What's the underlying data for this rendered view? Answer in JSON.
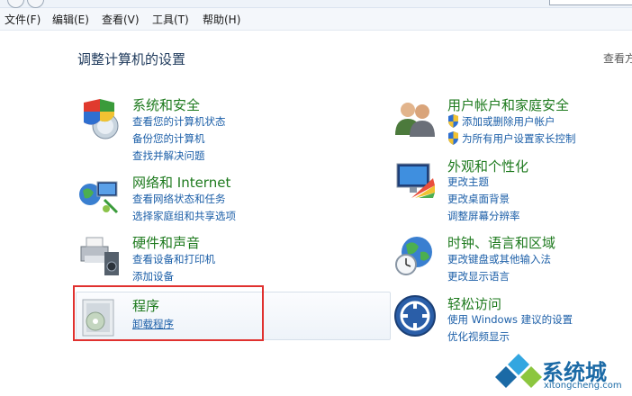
{
  "menu": [
    "文件(F)",
    "编辑(E)",
    "查看(V)",
    "工具(T)",
    "帮助(H)"
  ],
  "page_title": "调整计算机的设置",
  "view_by": "查看方",
  "categories": [
    {
      "title": "系统和安全",
      "icon": "shield-computer-icon",
      "links": [
        "查看您的计算机状态",
        "备份您的计算机",
        "查找并解决问题"
      ]
    },
    {
      "title": "网络和 Internet",
      "icon": "network-globe-icon",
      "links": [
        "查看网络状态和任务",
        "选择家庭组和共享选项"
      ]
    },
    {
      "title": "硬件和声音",
      "icon": "printer-speaker-icon",
      "links": [
        "查看设备和打印机",
        "添加设备"
      ]
    },
    {
      "title": "程序",
      "icon": "programs-disc-icon",
      "links": [
        "卸载程序"
      ]
    },
    {
      "title": "用户帐户和家庭安全",
      "icon": "users-icon",
      "links": [
        "添加或删除用户帐户",
        "为所有用户设置家长控制"
      ]
    },
    {
      "title": "外观和个性化",
      "icon": "monitor-palette-icon",
      "links": [
        "更改主题",
        "更改桌面背景",
        "调整屏幕分辨率"
      ]
    },
    {
      "title": "时钟、语言和区域",
      "icon": "globe-clock-icon",
      "links": [
        "更改键盘或其他输入法",
        "更改显示语言"
      ]
    },
    {
      "title": "轻松访问",
      "icon": "ease-of-access-icon",
      "links": [
        "使用 Windows 建议的设置",
        "优化视频显示"
      ]
    }
  ],
  "watermark": {
    "text": "系统城",
    "url": "xitongcheng.com"
  },
  "colors": {
    "category_title": "#1e7a1e",
    "link": "#1c5fa8",
    "highlight_border": "#e0312f"
  }
}
